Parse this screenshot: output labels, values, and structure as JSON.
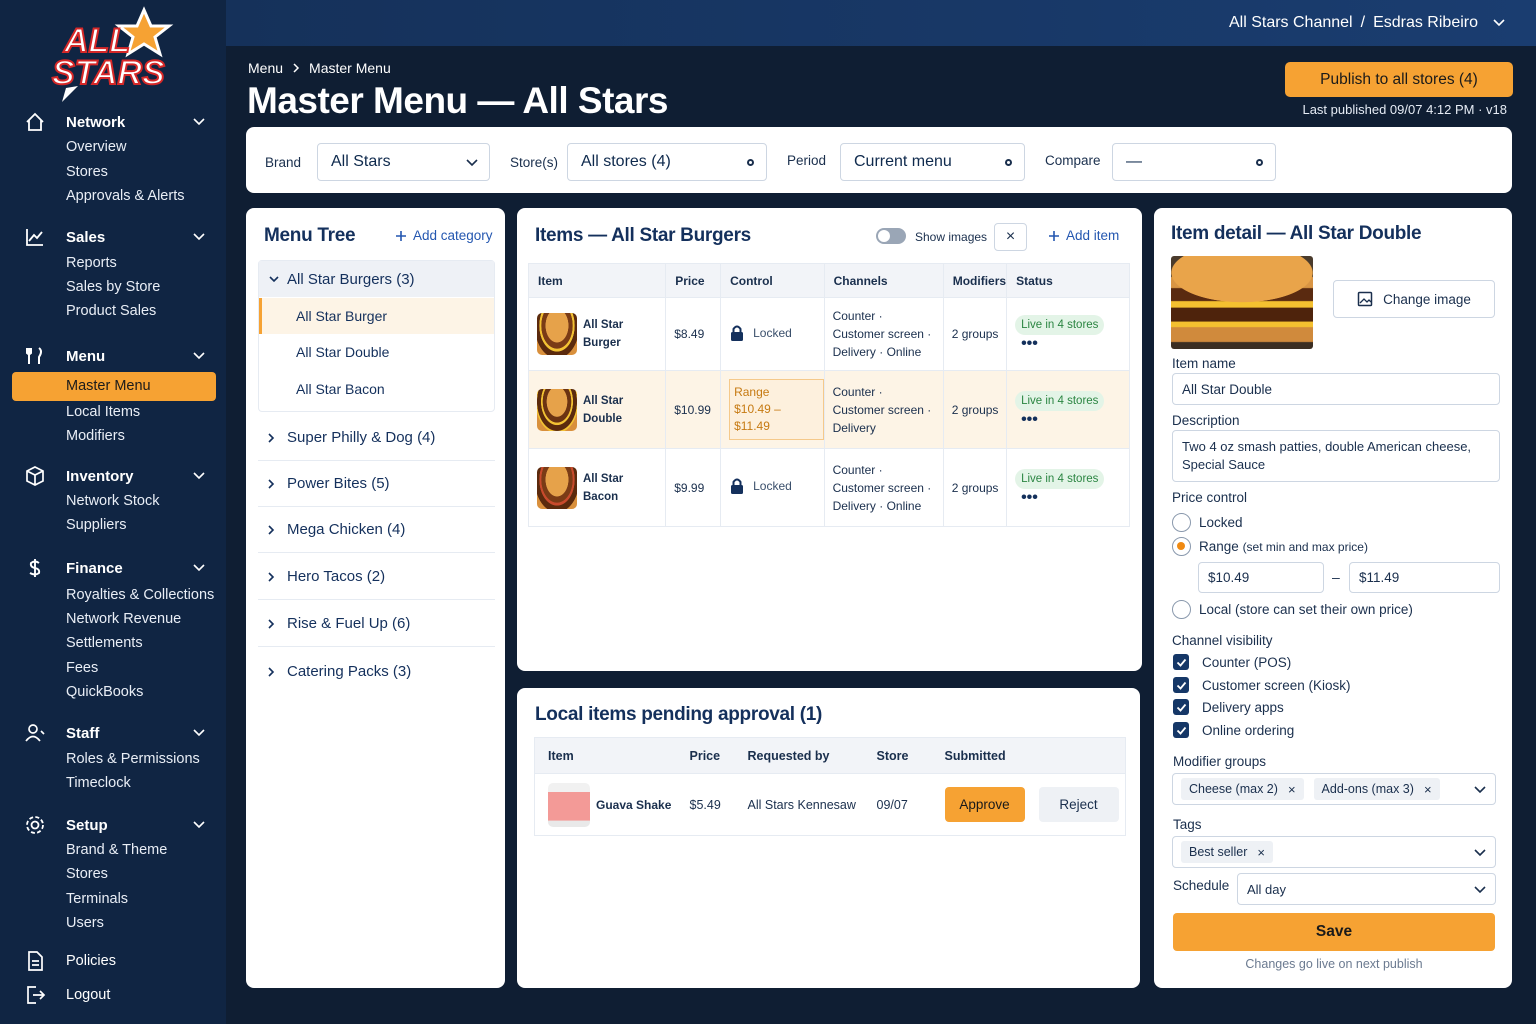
{
  "brand": {
    "logo_line1": "ALL",
    "logo_line2": "STARS",
    "accent": "#f6a233",
    "sidebar_bg": "#102543"
  },
  "topbar": {
    "channel": "All Stars Channel",
    "separator": "/",
    "user": "Esdras Ribeiro"
  },
  "nav": {
    "network": {
      "label": "Network",
      "items": [
        "Overview",
        "Stores",
        "Approvals & Alerts"
      ]
    },
    "sales": {
      "label": "Sales",
      "items": [
        "Reports",
        "Sales by Store",
        "Product Sales"
      ]
    },
    "menu": {
      "label": "Menu",
      "active": "Master Menu",
      "items": [
        "Local Items",
        "Modifiers"
      ]
    },
    "inventory": {
      "label": "Inventory",
      "items": [
        "Network Stock",
        "Suppliers"
      ]
    },
    "finance": {
      "label": "Finance",
      "items": [
        "Royalties & Collections",
        "Network Revenue",
        "Settlements",
        "Fees",
        "QuickBooks"
      ]
    },
    "staff": {
      "label": "Staff",
      "items": [
        "Roles & Permissions",
        "Timeclock"
      ]
    },
    "setup": {
      "label": "Setup",
      "items": [
        "Brand & Theme",
        "Stores",
        "Terminals",
        "Users"
      ]
    },
    "policies": "Policies",
    "logout": "Logout"
  },
  "page": {
    "breadcrumb": [
      "Menu",
      "Master Menu"
    ],
    "title": "Master Menu — All Stars",
    "publish_label": "Publish to all stores (4)",
    "last_published": "Last published 09/07 4:12 PM · v18"
  },
  "filters": {
    "brand_label": "Brand",
    "brand_value": "All Stars",
    "stores_label": "Store(s)",
    "stores_value": "All stores (4)",
    "period_label": "Period",
    "period_value": "Current menu",
    "compare_label": "Compare",
    "compare_value": "—"
  },
  "menu_tree": {
    "title": "Menu Tree",
    "add_label": "Add category",
    "open_category": "All Star Burgers (3)",
    "open_items": [
      "All Star Burger",
      "All Star Double",
      "All Star Bacon"
    ],
    "categories": [
      "Super Philly & Dog (4)",
      "Power Bites (5)",
      "Mega Chicken (4)",
      "Hero Tacos (2)",
      "Rise & Fuel Up (6)",
      "Catering Packs (3)"
    ]
  },
  "items_panel": {
    "title": "Items — All Star Burgers",
    "show_images": "Show images",
    "close": "×",
    "add_item": "Add item",
    "columns": [
      "Item",
      "Price",
      "Control",
      "Channels",
      "Modifiers",
      "Status"
    ],
    "rows": [
      {
        "name": "All Star Burger",
        "price": "$8.49",
        "control": "Locked",
        "channels": "Counter · Customer screen · Delivery · Online",
        "modifiers": "2 groups",
        "status": "Live in 4 stores"
      },
      {
        "name": "All Star Double",
        "price": "$10.99",
        "control_label": "Range",
        "control_range": "$10.49 – $11.49",
        "channels": "Counter · Customer screen · Delivery",
        "modifiers": "2 groups",
        "status": "Live in 4 stores"
      },
      {
        "name": "All Star Bacon",
        "price": "$9.99",
        "control": "Locked",
        "channels": "Counter · Customer screen · Delivery · Online",
        "modifiers": "2 groups",
        "status": "Live in 4 stores"
      }
    ],
    "more": "•••"
  },
  "pending": {
    "title": "Local items pending approval (1)",
    "columns": [
      "Item",
      "Price",
      "Requested by",
      "Store",
      "Submitted"
    ],
    "row": {
      "name": "Guava Shake",
      "price": "$5.49",
      "requested_by": "All Stars Kennesaw",
      "store": "09/07"
    },
    "approve": "Approve",
    "reject": "Reject"
  },
  "detail": {
    "title": "Item detail — All Star Double",
    "change_image": "Change image",
    "name_label": "Item name",
    "name_value": "All Star Double",
    "desc_label": "Description",
    "desc_value": "Two 4 oz smash patties, double American cheese, Special Sauce",
    "price_control_label": "Price control",
    "opt_locked": "Locked",
    "opt_range": "Range",
    "opt_range_hint": "(set min and max price)",
    "range_min": "$10.49",
    "range_dash": "–",
    "range_max": "$11.49",
    "opt_local": "Local (store can set their own price)",
    "channel_label": "Channel visibility",
    "channels": [
      "Counter (POS)",
      "Customer screen (Kiosk)",
      "Delivery apps",
      "Online ordering"
    ],
    "modifier_label": "Modifier groups",
    "modifiers": [
      "Cheese (max 2)",
      "Add-ons (max 3)"
    ],
    "tags_label": "Tags",
    "tags": [
      "Best seller"
    ],
    "schedule_label": "Schedule",
    "schedule_value": "All day",
    "save": "Save",
    "footer": "Changes go live on next publish"
  }
}
